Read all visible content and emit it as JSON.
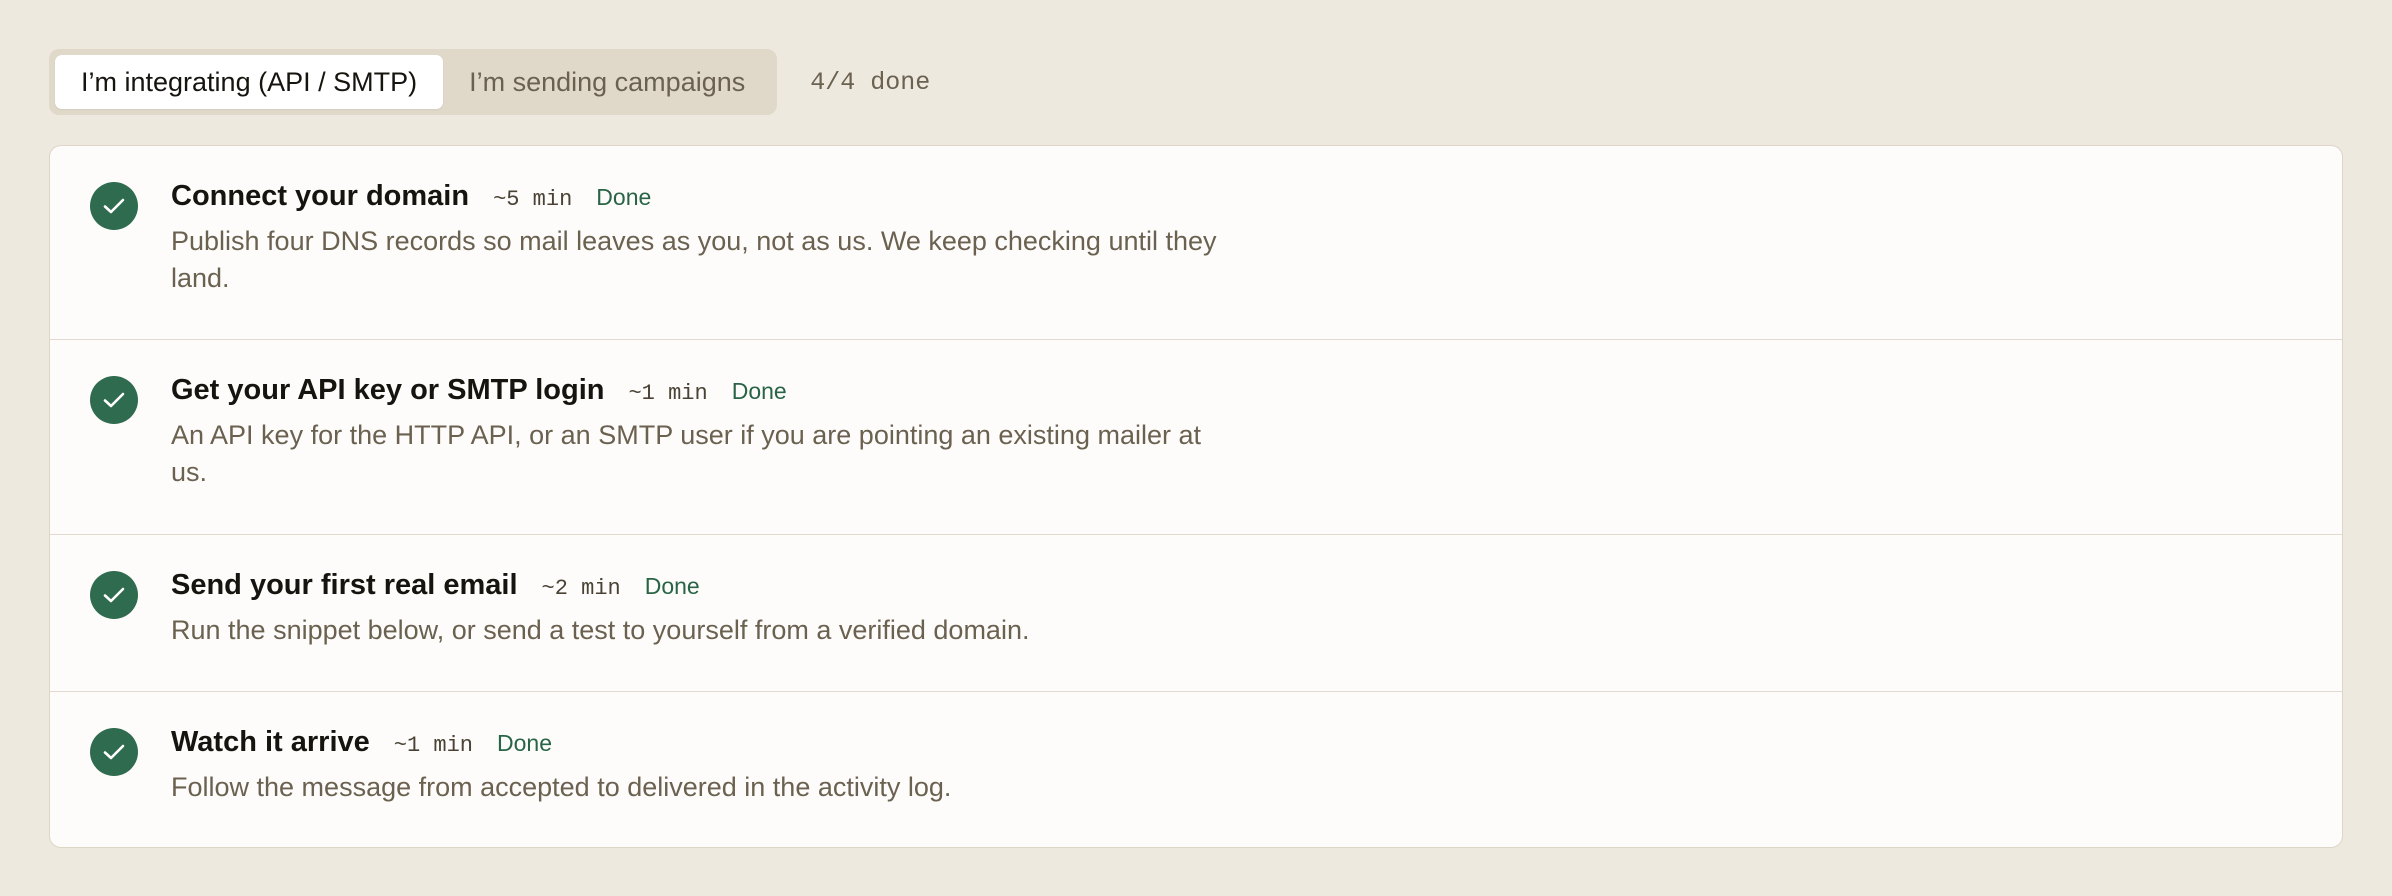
{
  "mode_toggle": {
    "options": [
      "I’m integrating (API / SMTP)",
      "I’m sending campaigns"
    ],
    "selected": "I’m integrating (API / SMTP)"
  },
  "progress_label": "4/4 done",
  "colors": {
    "background": "#eee9df",
    "card": "#fdfcfa",
    "accent_green": "#2f6b4f",
    "done_text": "#2a6447"
  },
  "steps": [
    {
      "title": "Connect your domain",
      "time": "~5 min",
      "status": "Done",
      "icon": "check-circle-icon",
      "description": "Publish four DNS records so mail leaves as you, not as us. We keep checking until they land."
    },
    {
      "title": "Get your API key or SMTP login",
      "time": "~1 min",
      "status": "Done",
      "icon": "check-circle-icon",
      "description": "An API key for the HTTP API, or an SMTP user if you are pointing an existing mailer at us."
    },
    {
      "title": "Send your first real email",
      "time": "~2 min",
      "status": "Done",
      "icon": "check-circle-icon",
      "description": "Run the snippet below, or send a test to yourself from a verified domain."
    },
    {
      "title": "Watch it arrive",
      "time": "~1 min",
      "status": "Done",
      "icon": "check-circle-icon",
      "description": "Follow the message from accepted to delivered in the activity log."
    }
  ]
}
